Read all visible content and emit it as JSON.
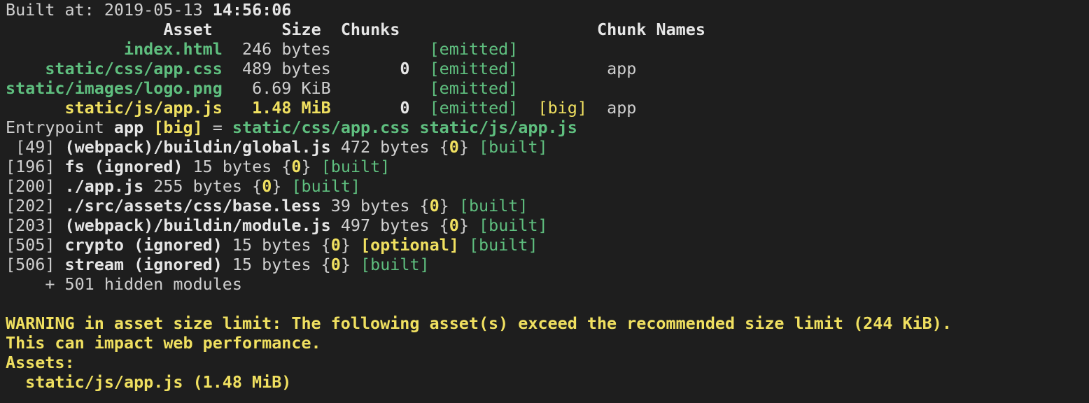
{
  "built": {
    "prefix": "Built at: 2019-05-13 ",
    "time": "14:56:06"
  },
  "table": {
    "header": {
      "asset": "Asset",
      "size": "Size",
      "chunks": "Chunks",
      "chunk_names": "Chunk Names"
    },
    "rows": [
      {
        "asset": "index.html",
        "size": "246 bytes",
        "chunks": "",
        "status": "[emitted]",
        "flag": "",
        "name": ""
      },
      {
        "asset": "static/css/app.css",
        "size": "489 bytes",
        "chunks": "0",
        "status": "[emitted]",
        "flag": "",
        "name": "app"
      },
      {
        "asset": "static/images/logo.png",
        "size": "6.69 KiB",
        "chunks": "",
        "status": "[emitted]",
        "flag": "",
        "name": ""
      },
      {
        "asset": "static/js/app.js",
        "size": "1.48 MiB",
        "chunks": "0",
        "status": "[emitted]",
        "flag": "[big]",
        "name": "app"
      }
    ]
  },
  "entrypoint": {
    "label": "Entrypoint ",
    "name": "app",
    "flag": "[big]",
    "eq": " = ",
    "files": "static/css/app.css static/js/app.js"
  },
  "modules": [
    {
      "id": " [49]",
      "name": "(webpack)/buildin/global.js",
      "size": " 472 bytes {",
      "chunk": "0",
      "close": "}",
      "optional": "",
      "built": "[built]"
    },
    {
      "id": "[196]",
      "name": "fs (ignored)",
      "size": " 15 bytes {",
      "chunk": "0",
      "close": "}",
      "optional": "",
      "built": "[built]"
    },
    {
      "id": "[200]",
      "name": "./app.js",
      "size": " 255 bytes {",
      "chunk": "0",
      "close": "}",
      "optional": "",
      "built": "[built]"
    },
    {
      "id": "[202]",
      "name": "./src/assets/css/base.less",
      "size": " 39 bytes {",
      "chunk": "0",
      "close": "}",
      "optional": "",
      "built": "[built]"
    },
    {
      "id": "[203]",
      "name": "(webpack)/buildin/module.js",
      "size": " 497 bytes {",
      "chunk": "0",
      "close": "}",
      "optional": "",
      "built": "[built]"
    },
    {
      "id": "[505]",
      "name": "crypto (ignored)",
      "size": " 15 bytes {",
      "chunk": "0",
      "close": "}",
      "optional": "[optional]",
      "built": "[built]"
    },
    {
      "id": "[506]",
      "name": "stream (ignored)",
      "size": " 15 bytes {",
      "chunk": "0",
      "close": "}",
      "optional": "",
      "built": "[built]"
    }
  ],
  "hidden": "    + 501 hidden modules",
  "warning": {
    "line1": "WARNING in asset size limit: The following asset(s) exceed the recommended size limit (244 KiB).",
    "line2": "This can impact web performance.",
    "line3": "Assets:",
    "line4": "  static/js/app.js (1.48 MiB)"
  },
  "colors": {
    "background": "#1e1e1e",
    "text": "#cfcfcf",
    "green": "#5fbf7f",
    "yellow": "#f0e060"
  }
}
